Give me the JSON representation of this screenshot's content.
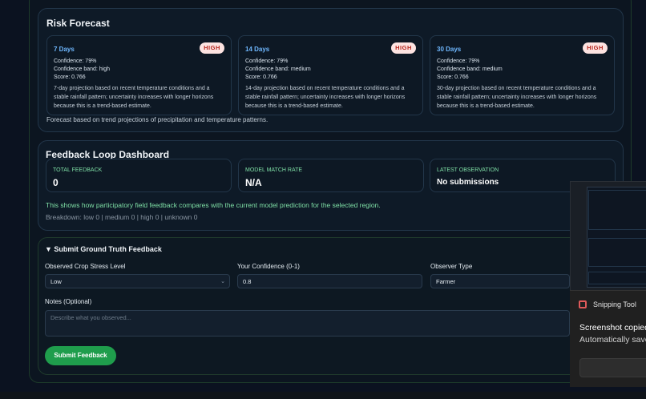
{
  "risk_forecast": {
    "title": "Risk Forecast",
    "cards": [
      {
        "days": "7 Days",
        "badge": "HIGH",
        "confidence": "Confidence: 79%",
        "band": "Confidence band: high",
        "score": "Score: 0.766",
        "desc": "7-day projection based on recent temperature conditions and a stable rainfall pattern; uncertainty increases with longer horizons because this is a trend-based estimate."
      },
      {
        "days": "14 Days",
        "badge": "HIGH",
        "confidence": "Confidence: 79%",
        "band": "Confidence band: medium",
        "score": "Score: 0.766",
        "desc": "14-day projection based on recent temperature conditions and a stable rainfall pattern; uncertainty increases with longer horizons because this is a trend-based estimate."
      },
      {
        "days": "30 Days",
        "badge": "HIGH",
        "confidence": "Confidence: 79%",
        "band": "Confidence band: medium",
        "score": "Score: 0.766",
        "desc": "30-day projection based on recent temperature conditions and a stable rainfall pattern; uncertainty increases with longer horizons because this is a trend-based estimate."
      }
    ],
    "footnote": "Forecast based on trend projections of precipitation and temperature patterns."
  },
  "feedback_dashboard": {
    "title": "Feedback Loop Dashboard",
    "metrics": [
      {
        "label": "TOTAL FEEDBACK",
        "value": "0"
      },
      {
        "label": "MODEL MATCH RATE",
        "value": "N/A"
      },
      {
        "label": "LATEST OBSERVATION",
        "value": "No submissions"
      }
    ],
    "description": "This shows how participatory field feedback compares with the current model prediction for the selected region.",
    "breakdown": "Breakdown: low 0 | medium 0 | high 0 | unknown 0"
  },
  "submit_form": {
    "title": "▼ Submit Ground Truth Feedback",
    "stress_label": "Observed Crop Stress Level",
    "stress_value": "Low",
    "confidence_label": "Your Confidence (0-1)",
    "confidence_value": "0.8",
    "observer_label": "Observer Type",
    "observer_value": "Farmer",
    "notes_label": "Notes (Optional)",
    "notes_placeholder": "Describe what you observed...",
    "submit_label": "Submit Feedback"
  },
  "snipping": {
    "app_name": "Snipping Tool",
    "message": "Screenshot copied",
    "sub": "Automatically save"
  },
  "colors": {
    "accent_green": "#1f9d4c",
    "badge_bg": "#fde3e1",
    "badge_text": "#b4231b",
    "label_blue": "#6fb8ff",
    "metric_label_green": "#7fe0a6"
  }
}
